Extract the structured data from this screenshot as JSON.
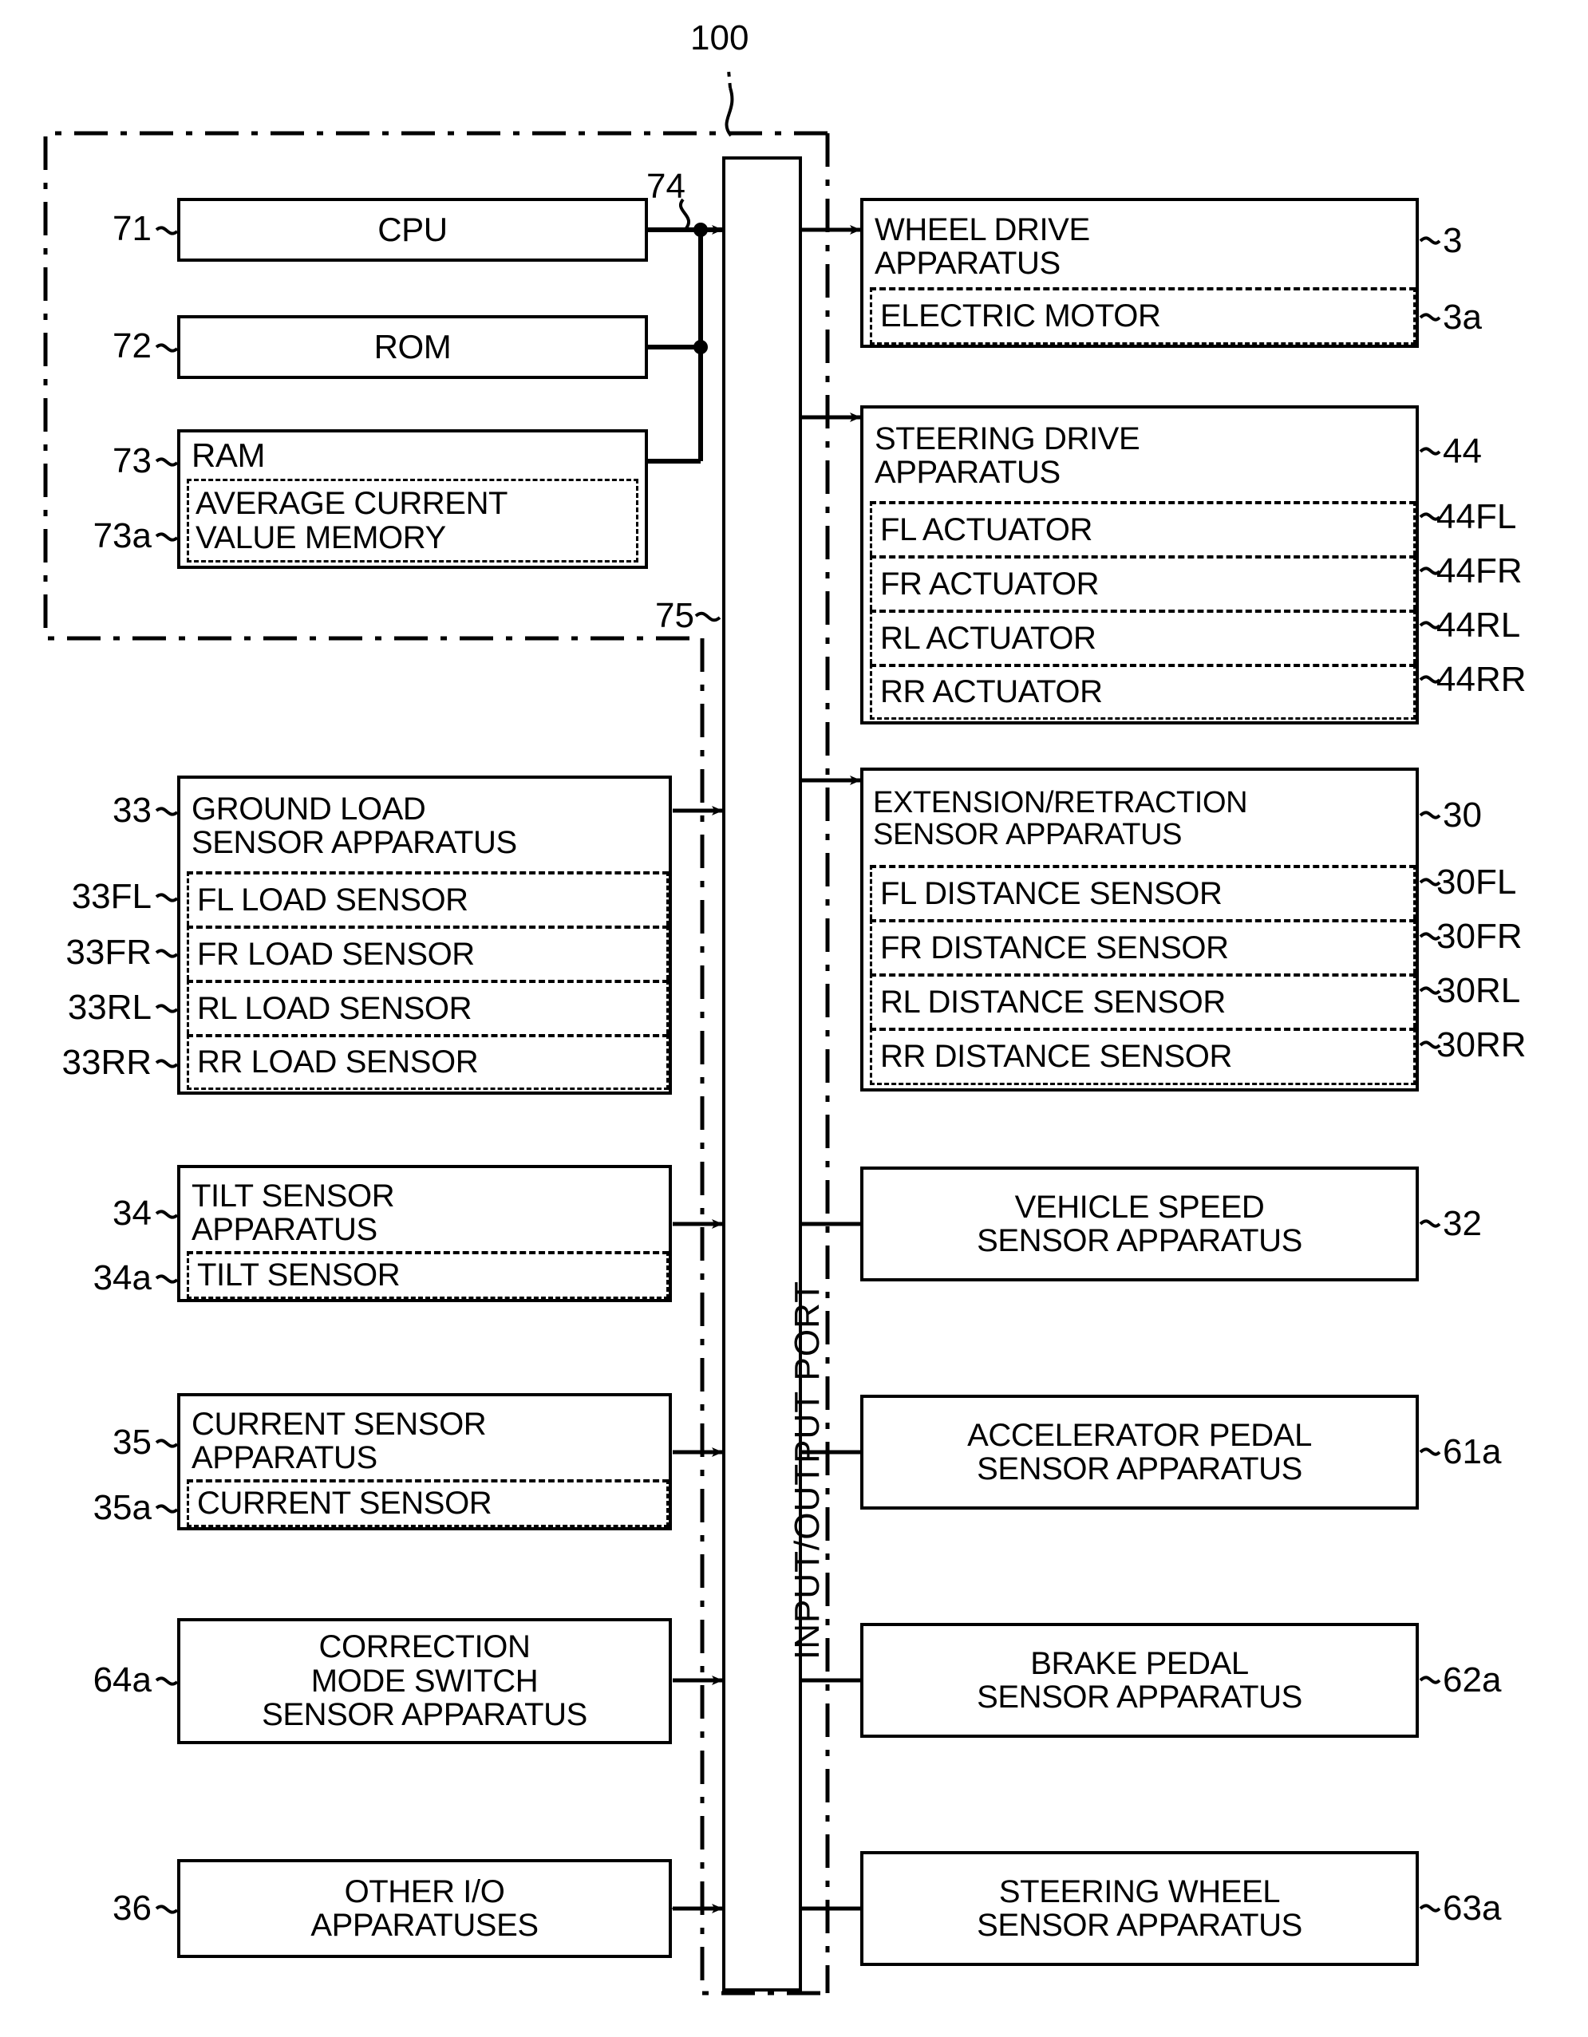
{
  "figure": {
    "system_ref": "100",
    "ecu_ref_bus": "74",
    "io_port_ref": "75",
    "io_port_label": "INPUT/OUTPUT PORT"
  },
  "ecu": {
    "cpu": {
      "ref": "71",
      "label": "CPU"
    },
    "rom": {
      "ref": "72",
      "label": "ROM"
    },
    "ram": {
      "ref": "73",
      "label": "RAM",
      "sub": {
        "ref": "73a",
        "label": "AVERAGE CURRENT\nVALUE MEMORY"
      }
    }
  },
  "left_blocks": [
    {
      "ref": "33",
      "label": "GROUND LOAD\nSENSOR APPARATUS",
      "align": "left",
      "children": [
        {
          "ref": "33FL",
          "label": "FL LOAD SENSOR"
        },
        {
          "ref": "33FR",
          "label": "FR LOAD SENSOR"
        },
        {
          "ref": "33RL",
          "label": "RL LOAD SENSOR"
        },
        {
          "ref": "33RR",
          "label": "RR LOAD SENSOR"
        }
      ]
    },
    {
      "ref": "34",
      "label": "TILT SENSOR\nAPPARATUS",
      "align": "left",
      "children": [
        {
          "ref": "34a",
          "label": "TILT SENSOR"
        }
      ]
    },
    {
      "ref": "35",
      "label": "CURRENT SENSOR\nAPPARATUS",
      "align": "left",
      "children": [
        {
          "ref": "35a",
          "label": "CURRENT SENSOR"
        }
      ]
    },
    {
      "ref": "64a",
      "label": "CORRECTION\nMODE SWITCH\nSENSOR APPARATUS",
      "align": "center",
      "children": []
    },
    {
      "ref": "36",
      "label": "OTHER I/O\nAPPARATUSES",
      "align": "center",
      "children": []
    }
  ],
  "right_blocks": [
    {
      "ref": "3",
      "label": "WHEEL DRIVE\nAPPARATUS",
      "align": "left",
      "children": [
        {
          "ref": "3a",
          "label": "ELECTRIC MOTOR"
        }
      ]
    },
    {
      "ref": "44",
      "label": "STEERING DRIVE\nAPPARATUS",
      "align": "left",
      "children": [
        {
          "ref": "44FL",
          "label": "FL ACTUATOR"
        },
        {
          "ref": "44FR",
          "label": "FR ACTUATOR"
        },
        {
          "ref": "44RL",
          "label": "RL ACTUATOR"
        },
        {
          "ref": "44RR",
          "label": "RR ACTUATOR"
        }
      ]
    },
    {
      "ref": "30",
      "label": "EXTENSION/RETRACTION\nSENSOR APPARATUS",
      "align": "left",
      "children": [
        {
          "ref": "30FL",
          "label": "FL DISTANCE SENSOR"
        },
        {
          "ref": "30FR",
          "label": "FR DISTANCE SENSOR"
        },
        {
          "ref": "30RL",
          "label": "RL DISTANCE SENSOR"
        },
        {
          "ref": "30RR",
          "label": "RR DISTANCE SENSOR"
        }
      ]
    },
    {
      "ref": "32",
      "label": "VEHICLE SPEED\nSENSOR APPARATUS",
      "align": "center",
      "children": []
    },
    {
      "ref": "61a",
      "label": "ACCELERATOR PEDAL\nSENSOR APPARATUS",
      "align": "center",
      "children": []
    },
    {
      "ref": "62a",
      "label": "BRAKE PEDAL\nSENSOR APPARATUS",
      "align": "center",
      "children": []
    },
    {
      "ref": "63a",
      "label": "STEERING WHEEL\nSENSOR APPARATUS",
      "align": "center",
      "children": []
    }
  ],
  "colors": {
    "ink": "#000000",
    "paper": "#ffffff"
  }
}
